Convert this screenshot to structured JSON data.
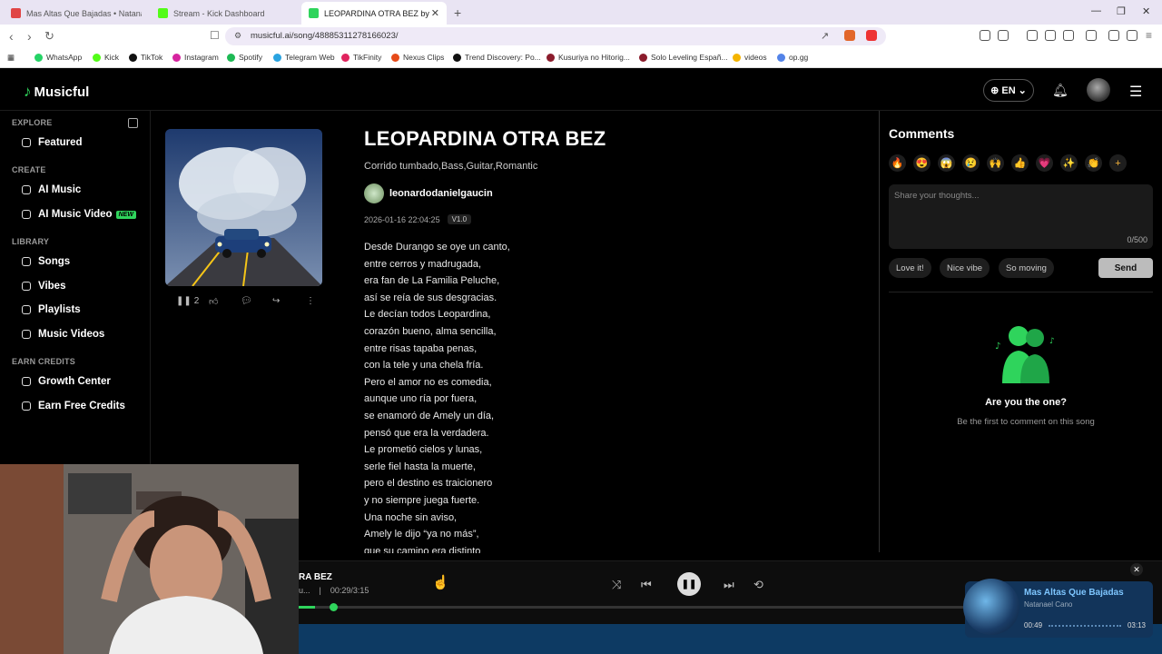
{
  "browser": {
    "tabs": [
      {
        "title": "Mas Altas Que Bajadas • Natanael Ca",
        "color": "#e04545"
      },
      {
        "title": "Stream - Kick Dashboard",
        "color": "#53fc18"
      },
      {
        "title": "LEOPARDINA OTRA BEZ by le",
        "color": "#2fd45c",
        "active": true
      }
    ],
    "url": "musicful.ai/song/48885311278166023/",
    "bookmarks": [
      {
        "label": "WhatsApp",
        "color": "#25d366"
      },
      {
        "label": "Kick",
        "color": "#53fc18"
      },
      {
        "label": "TikTok",
        "color": "#111111"
      },
      {
        "label": "Instagram",
        "color": "#d6249f"
      },
      {
        "label": "Spotify",
        "color": "#1db954"
      },
      {
        "label": "Telegram Web",
        "color": "#2aa3e0"
      },
      {
        "label": "TikFinity",
        "color": "#e0245e"
      },
      {
        "label": "Nexus Clips",
        "color": "#e64a19"
      },
      {
        "label": "Trend Discovery: Po...",
        "color": "#111111"
      },
      {
        "label": "Kusuriya no Hitorig...",
        "color": "#8b1c2c"
      },
      {
        "label": "Solo Leveling Españ...",
        "color": "#8b1c2c"
      },
      {
        "label": "videos",
        "color": "#f4b400"
      },
      {
        "label": "op.gg",
        "color": "#5383e8"
      }
    ]
  },
  "header": {
    "logo": "Musicful",
    "lang": "EN"
  },
  "sidebar": {
    "sections": [
      {
        "label": "EXPLORE",
        "items": [
          {
            "label": "Featured"
          }
        ]
      },
      {
        "label": "CREATE",
        "items": [
          {
            "label": "AI Music"
          },
          {
            "label": "AI Music Video",
            "badge": "NEW"
          }
        ]
      },
      {
        "label": "LIBRARY",
        "items": [
          {
            "label": "Songs"
          },
          {
            "label": "Vibes"
          },
          {
            "label": "Playlists"
          },
          {
            "label": "Music Videos"
          }
        ]
      },
      {
        "label": "EARN CREDITS",
        "items": [
          {
            "label": "Growth Center"
          },
          {
            "label": "Earn Free Credits"
          }
        ]
      }
    ]
  },
  "song": {
    "title": "LEOPARDINA OTRA BEZ",
    "genres": "Corrido tumbado,Bass,Guitar,Romantic",
    "author": "leonardodanielgaucin",
    "date": "2026-01-16 22:04:25",
    "version": "V1.0",
    "play_count": "2",
    "lyrics": [
      "Desde Durango se oye un canto,",
      "entre cerros y madrugada,",
      "era fan de La Familia Peluche,",
      "así se reía de sus desgracias.",
      "Le decían todos Leopardina,",
      "corazón bueno, alma sencilla,",
      "entre risas tapaba penas,",
      "con la tele y una chela fría.",
      "Pero el amor no es comedia,",
      "aunque uno ría por fuera,",
      "se enamoró de Amely un día,",
      "pensó que era la verdadera.",
      "Le prometió cielos y lunas,",
      "serle fiel hasta la muerte,",
      "pero el destino es traicionero",
      "y no siempre juega fuerte.",
      "Una noche sin aviso,",
      "Amely le dijo “ya no más”,",
      "que su camino era distinto"
    ]
  },
  "comments": {
    "title": "Comments",
    "emojis": [
      "🔥",
      "😍",
      "😱",
      "😢",
      "🙌",
      "👍",
      "💗",
      "✨",
      "👏",
      "+"
    ],
    "placeholder": "Share your thoughts...",
    "count": "0/500",
    "chips": [
      "Love it!",
      "Nice vibe",
      "So moving"
    ],
    "send": "Send",
    "empty_title": "Are you the one?",
    "empty_sub": "Be the first to comment on this song"
  },
  "player": {
    "title": "RA BEZ",
    "artist": "u...",
    "time": "00:29/3:15",
    "progress": 0.025
  },
  "media_popup": {
    "title": "Mas Altas Que Bajadas",
    "artist": "Natanael Cano",
    "elapsed": "00:49",
    "duration": "03:13"
  }
}
